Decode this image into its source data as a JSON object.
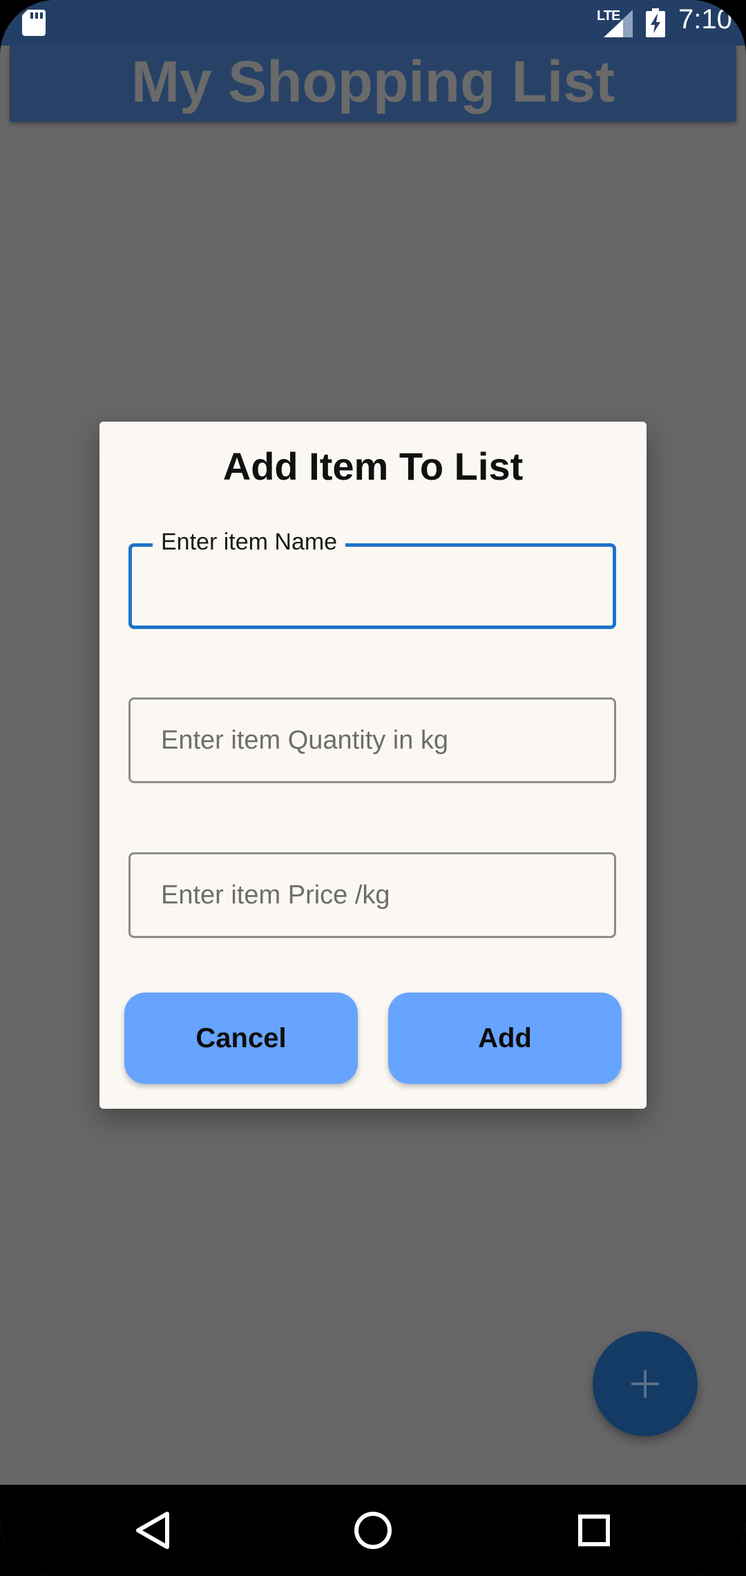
{
  "status_bar": {
    "network_type": "LTE",
    "time": "7:10",
    "icons": [
      "sd-card-icon",
      "signal-icon",
      "battery-charging-icon"
    ]
  },
  "app_bar": {
    "title": "My Shopping List",
    "color": "#284267"
  },
  "dialog": {
    "title": "Add Item To List",
    "fields": [
      {
        "label": "Enter item Name",
        "value": "",
        "focused": true
      },
      {
        "placeholder": "Enter item Quantity in kg",
        "value": ""
      },
      {
        "placeholder": "Enter item Price /kg",
        "value": ""
      }
    ],
    "buttons": {
      "cancel": "Cancel",
      "add": "Add"
    },
    "accent_color": "#1e73c8",
    "button_color": "#67a4ff"
  },
  "fab": {
    "icon": "plus-icon"
  },
  "nav_bar": {
    "icons": [
      "back-icon",
      "home-icon",
      "recents-icon"
    ]
  }
}
